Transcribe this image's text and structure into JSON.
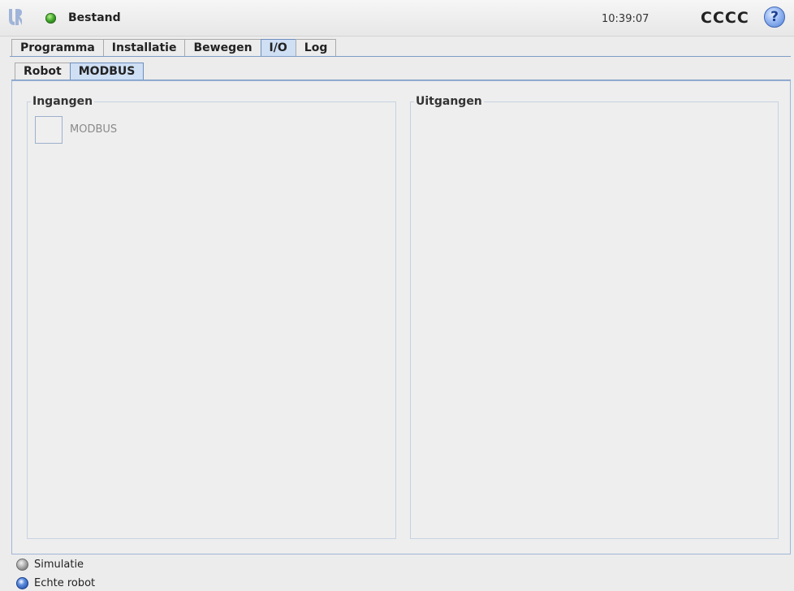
{
  "header": {
    "logo_icon": "ur-logo-icon",
    "status_icon": "status-green-dot-icon",
    "file_name": "Bestand",
    "clock": "10:39:07",
    "robot_name": "CCCC",
    "help_icon": "help-question-icon",
    "help_glyph": "?"
  },
  "main_tabs": [
    {
      "label": "Programma",
      "active": false
    },
    {
      "label": "Installatie",
      "active": false
    },
    {
      "label": "Bewegen",
      "active": false
    },
    {
      "label": "I/O",
      "active": true
    },
    {
      "label": "Log",
      "active": false
    }
  ],
  "sub_tabs": [
    {
      "label": "Robot",
      "active": false
    },
    {
      "label": "MODBUS",
      "active": true
    }
  ],
  "inputs_group": {
    "title": "Ingangen",
    "items": [
      {
        "label": "MODBUS"
      }
    ]
  },
  "outputs_group": {
    "title": "Uitgangen"
  },
  "footer": {
    "simulation_label": "Simulatie",
    "real_robot_label": "Echte robot",
    "selected": "Echte robot"
  },
  "colors": {
    "accent": "#cfdff4",
    "border_accent": "#7e9cc6",
    "status_green": "#3fa62a",
    "help_blue": "#4f7fd6"
  }
}
